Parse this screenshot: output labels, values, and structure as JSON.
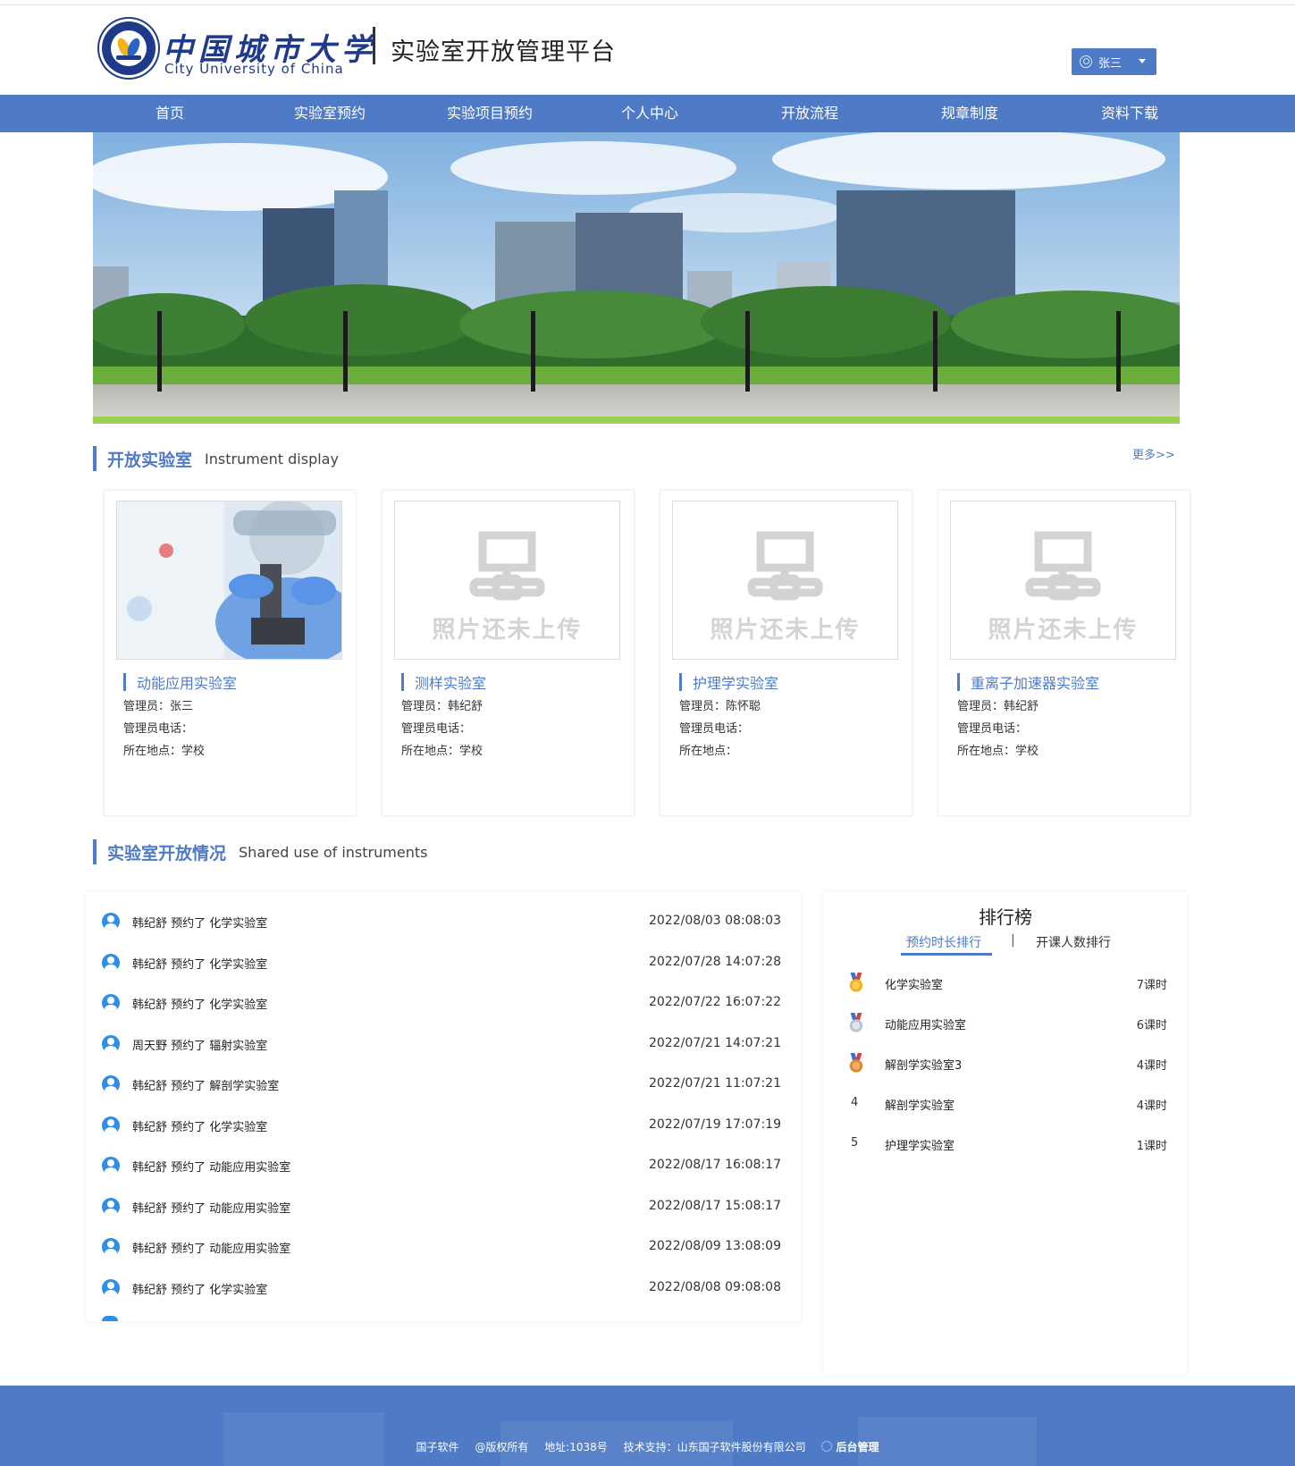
{
  "header": {
    "logo_cn": "中国城市大学",
    "logo_en": "City University of China",
    "platform_title": "实验室开放管理平台",
    "user_name": "张三"
  },
  "nav": [
    "首页",
    "实验室预约",
    "实验项目预约",
    "个人中心",
    "开放流程",
    "规章制度",
    "资料下载"
  ],
  "open_labs": {
    "title_cn": "开放实验室",
    "title_en": "Instrument display",
    "more": "更多>>",
    "placeholder": "照片还未上传",
    "cards": [
      {
        "name": "动能应用实验室",
        "manager": "管理员：张三",
        "phone": "管理员电话：",
        "location": "所在地点：学校",
        "has_photo": true
      },
      {
        "name": "测样实验室",
        "manager": "管理员：韩纪舒",
        "phone": "管理员电话：",
        "location": "所在地点：学校",
        "has_photo": false
      },
      {
        "name": "护理学实验室",
        "manager": "管理员：陈怀聪",
        "phone": "管理员电话：",
        "location": "所在地点：",
        "has_photo": false
      },
      {
        "name": "重离子加速器实验室",
        "manager": "管理员：韩纪舒",
        "phone": "管理员电话：",
        "location": "所在地点：学校",
        "has_photo": false
      }
    ]
  },
  "usage": {
    "title_cn": "实验室开放情况",
    "title_en": "Shared use of instruments",
    "rows": [
      {
        "text": "韩纪舒 预约了 化学实验室",
        "time": "2022/08/03 08:08:03"
      },
      {
        "text": "韩纪舒 预约了 化学实验室",
        "time": "2022/07/28 14:07:28"
      },
      {
        "text": "韩纪舒 预约了 化学实验室",
        "time": "2022/07/22 16:07:22"
      },
      {
        "text": "周天野 预约了 辐射实验室",
        "time": "2022/07/21 14:07:21"
      },
      {
        "text": "韩纪舒 预约了 解剖学实验室",
        "time": "2022/07/21 11:07:21"
      },
      {
        "text": "韩纪舒 预约了 化学实验室",
        "time": "2022/07/19 17:07:19"
      },
      {
        "text": "韩纪舒 预约了 动能应用实验室",
        "time": "2022/08/17 16:08:17"
      },
      {
        "text": "韩纪舒 预约了 动能应用实验室",
        "time": "2022/08/17 15:08:17"
      },
      {
        "text": "韩纪舒 预约了 动能应用实验室",
        "time": "2022/08/09 13:08:09"
      },
      {
        "text": "韩纪舒 预约了 化学实验室",
        "time": "2022/08/08 09:08:08"
      }
    ]
  },
  "ranking": {
    "title": "排行榜",
    "tab_duration": "预约时长排行",
    "tab_separator": "|",
    "tab_people": "开课人数排行",
    "rows": [
      {
        "rank": "1",
        "lab": "化学实验室",
        "hours": "7课时",
        "medal": "gold"
      },
      {
        "rank": "2",
        "lab": "动能应用实验室",
        "hours": "6课时",
        "medal": "silver"
      },
      {
        "rank": "3",
        "lab": "解剖学实验室3",
        "hours": "4课时",
        "medal": "bronze"
      },
      {
        "rank": "4",
        "lab": "解剖学实验室",
        "hours": "4课时",
        "medal": ""
      },
      {
        "rank": "5",
        "lab": "护理学实验室",
        "hours": "1课时",
        "medal": ""
      }
    ]
  },
  "footer": {
    "company": "国子软件",
    "copyright": "@版权所有",
    "address": "地址:1038号",
    "support": "技术支持：山东国子软件股份有限公司",
    "admin": "后台管理"
  },
  "colors": {
    "primary": "#4f7bc6",
    "brand_navy": "#1f3a8a",
    "avatar": "#2e8ee8"
  }
}
